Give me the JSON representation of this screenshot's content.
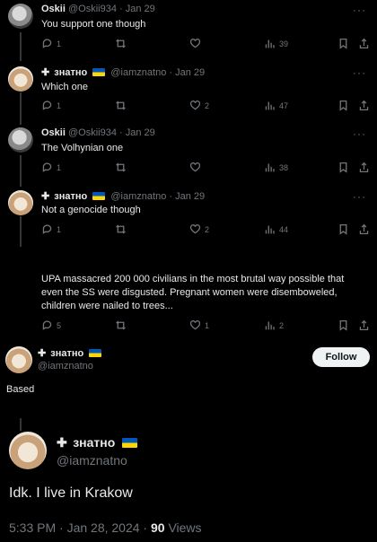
{
  "tweets": [
    {
      "name": "Oskii",
      "handle": "@Oskii934",
      "date": "Jan 29",
      "text": "You support one though",
      "replies": "1",
      "retweets": "",
      "likes": "",
      "views": "39"
    },
    {
      "name": "знатно",
      "handle": "@iamznatno",
      "date": "Jan 29",
      "text": "Which one",
      "replies": "1",
      "retweets": "",
      "likes": "2",
      "views": "47"
    },
    {
      "name": "Oskii",
      "handle": "@Oskii934",
      "date": "Jan 29",
      "text": "The Volhynian one",
      "replies": "1",
      "retweets": "",
      "likes": "",
      "views": "38"
    },
    {
      "name": "знатно",
      "handle": "@iamznatno",
      "date": "Jan 29",
      "text": "Not a genocide though",
      "replies": "1",
      "retweets": "",
      "likes": "2",
      "views": "44"
    },
    {
      "text": "UPA massacred 200 000 civilians in the most brutal way possible that even the SS were disgusted. Pregnant women were disemboweled, children were nailed to trees...",
      "replies": "5",
      "retweets": "",
      "likes": "1",
      "views": "2"
    }
  ],
  "reply_author": {
    "name": "знатно",
    "handle": "@iamznatno",
    "text": "Based",
    "follow_label": "Follow"
  },
  "main_tweet": {
    "name": "знатно",
    "handle": "@iamznatno",
    "text": "Idk. I live in Krakow",
    "time": "5:33 PM · Jan 28, 2024 ·",
    "views_count": "90",
    "views_label": "Views"
  },
  "colors": {
    "background": "#000000",
    "text": "#e7e9ea",
    "muted": "#71767b",
    "flag_blue": "#0057b7",
    "flag_yellow": "#ffd700"
  },
  "icons": [
    "reply-icon",
    "retweet-icon",
    "like-icon",
    "views-icon",
    "bookmark-icon",
    "share-icon",
    "more-icon"
  ]
}
